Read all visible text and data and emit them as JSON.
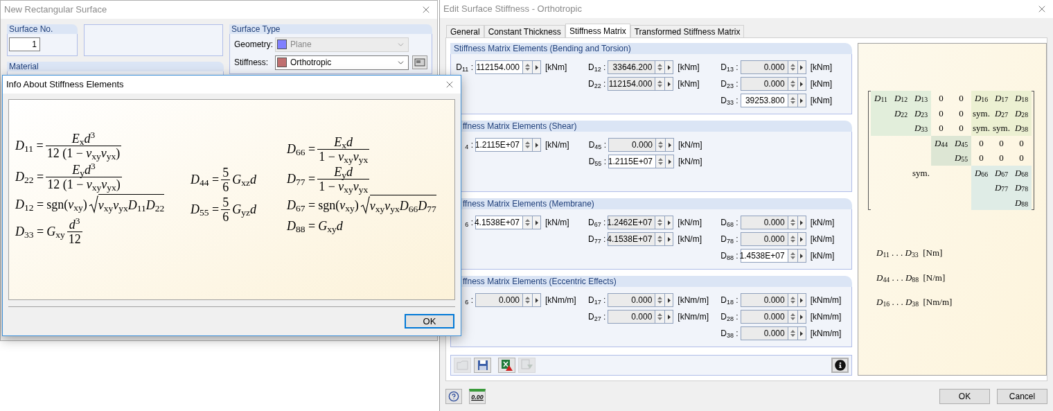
{
  "left_window": {
    "title": "New Rectangular Surface",
    "surface_no": {
      "label": "Surface No.",
      "value": "1"
    },
    "surface_type": {
      "title": "Surface Type",
      "rows": [
        {
          "label": "Geometry:",
          "value": "Plane",
          "color": "#8080ff",
          "disabled": true
        },
        {
          "label": "Stiffness:",
          "value": "Orthotropic",
          "color": "#c07070",
          "disabled": false
        }
      ]
    },
    "material": {
      "title": "Material"
    }
  },
  "info_dialog": {
    "title": "Info About Stiffness Elements",
    "columns": [
      [
        {
          "kind": "fraction",
          "lhs": "*D*$_{11}$ =",
          "num": "*E*$_{x}$*d*$^{3}$",
          "den": "12 (1 − *ν*$_{xy}$*ν*$_{yx}$)"
        },
        {
          "kind": "fraction",
          "lhs": "*D*$_{22}$ =",
          "num": "*E*$_{y}$*d*$^{3}$",
          "den": "12 (1 − *ν*$_{xy}$*ν*$_{yx}$)"
        },
        {
          "kind": "sqrt",
          "lhs": "*D*$_{12}$ =",
          "prefix": "sgn(*ν*$_{xy}$)",
          "radicand": "*ν*$_{xy}$*ν*$_{yx}$*D*$_{11}$*D*$_{22}$"
        },
        {
          "kind": "fraction",
          "lhs": "*D*$_{33}$ =",
          "prefix": "*G*$_{xy}$",
          "num": "*d*$^{3}$",
          "den": "12"
        }
      ],
      [
        {
          "kind": "fraction",
          "lhs": "*D*$_{44}$ =",
          "num": "5",
          "den": "6",
          "suffix": "*G*$_{xz}$*d*"
        },
        {
          "kind": "fraction",
          "lhs": "*D*$_{55}$ =",
          "num": "5",
          "den": "6",
          "suffix": "*G*$_{yz}$*d*"
        }
      ],
      [
        {
          "kind": "fraction",
          "lhs": "*D*$_{66}$ =",
          "num": "*E*$_{x}$*d*",
          "den": "1 − *ν*$_{xy}$*ν*$_{yx}$"
        },
        {
          "kind": "fraction",
          "lhs": "*D*$_{77}$ =",
          "num": "*E*$_{y}$*d*",
          "den": "1 − *ν*$_{xy}$*ν*$_{yx}$"
        },
        {
          "kind": "sqrt",
          "lhs": "*D*$_{67}$ =",
          "prefix": "sgn(*ν*$_{xy}$)",
          "radicand": "*ν*$_{xy}$*ν*$_{yx}$*D*$_{66}$*D*$_{77}$"
        },
        {
          "kind": "plain",
          "lhs": "*D*$_{88}$ =",
          "rhs": "*G*$_{xy}$*d*"
        }
      ]
    ],
    "ok": "OK"
  },
  "stiffness_window": {
    "title": "Edit Surface Stiffness - Orthotropic",
    "tabs": [
      {
        "label": "General",
        "selected": false
      },
      {
        "label": "Constant Thickness",
        "selected": false
      },
      {
        "label": "Stiffness Matrix",
        "selected": true
      },
      {
        "label": "Transformed Stiffness Matrix",
        "selected": false
      }
    ],
    "groups": [
      {
        "title": "Stiffness Matrix Elements (Bending and Torsion)",
        "covered": false,
        "rows": [
          [
            {
              "label": "D$_{11}$ :",
              "value": "112154.000",
              "unit": "[kNm]",
              "disabled": false
            },
            {
              "label": "D$_{12}$ :",
              "value": "33646.200",
              "unit": "[kNm]",
              "disabled": true
            },
            {
              "label": "D$_{13}$ :",
              "value": "0.000",
              "unit": "[kNm]",
              "disabled": true
            }
          ],
          [
            "",
            {
              "label": "D$_{22}$ :",
              "value": "112154.000",
              "unit": "[kNm]",
              "disabled": true
            },
            {
              "label": "D$_{23}$ :",
              "value": "0.000",
              "unit": "[kNm]",
              "disabled": true
            }
          ],
          [
            "",
            "",
            {
              "label": "D$_{33}$ :",
              "value": "39253.800",
              "unit": "[kNm]",
              "disabled": false
            }
          ]
        ]
      },
      {
        "title": "ffness Matrix Elements (Shear)",
        "covered": true,
        "rows": [
          [
            {
              "label": "$_{4}$ :",
              "value": "1.2115E+07",
              "unit": "[kN/m]",
              "disabled": false
            },
            {
              "label": "D$_{45}$ :",
              "value": "0.000",
              "unit": "[kN/m]",
              "disabled": true
            }
          ],
          [
            "",
            {
              "label": "D$_{55}$ :",
              "value": "1.2115E+07",
              "unit": "[kN/m]",
              "disabled": false
            }
          ]
        ]
      },
      {
        "title": "ffness Matrix Elements (Membrane)",
        "covered": true,
        "rows": [
          [
            {
              "label": "$_{6}$ :",
              "value": "4.1538E+07",
              "unit": "[kN/m]",
              "disabled": false
            },
            {
              "label": "D$_{67}$ :",
              "value": "1.2462E+07",
              "unit": "[kN/m]",
              "disabled": true
            },
            {
              "label": "D$_{68}$ :",
              "value": "0.000",
              "unit": "[kN/m]",
              "disabled": true
            }
          ],
          [
            "",
            {
              "label": "D$_{77}$ :",
              "value": "4.1538E+07",
              "unit": "[kN/m]",
              "disabled": true
            },
            {
              "label": "D$_{78}$ :",
              "value": "0.000",
              "unit": "[kN/m]",
              "disabled": true
            }
          ],
          [
            "",
            "",
            {
              "label": "D$_{88}$ :",
              "value": "1.4538E+07",
              "unit": "[kN/m]",
              "disabled": false
            }
          ]
        ]
      },
      {
        "title": "ffness Matrix Elements (Eccentric Effects)",
        "covered": true,
        "rows": [
          [
            {
              "label": "$_{6}$ :",
              "value": "0.000",
              "unit": "[kNm/m]",
              "disabled": true
            },
            {
              "label": "D$_{17}$ :",
              "value": "0.000",
              "unit": "[kNm/m]",
              "disabled": true
            },
            {
              "label": "D$_{18}$ :",
              "value": "0.000",
              "unit": "[kNm/m]",
              "disabled": true
            }
          ],
          [
            "",
            {
              "label": "D$_{27}$ :",
              "value": "0.000",
              "unit": "[kNm/m]",
              "disabled": true
            },
            {
              "label": "D$_{28}$ :",
              "value": "0.000",
              "unit": "[kNm/m]",
              "disabled": true
            }
          ],
          [
            "",
            "",
            {
              "label": "D$_{38}$ :",
              "value": "0.000",
              "unit": "[kNm/m]",
              "disabled": true
            }
          ]
        ]
      }
    ],
    "toolbar": [
      {
        "kind": "folder",
        "disabled": true,
        "pressed": false
      },
      {
        "kind": "save",
        "disabled": false,
        "pressed": false
      },
      {
        "kind": "excel",
        "disabled": false,
        "pressed": false
      },
      {
        "kind": "import",
        "disabled": true,
        "pressed": false
      },
      {
        "kind": "info",
        "disabled": false,
        "pressed": true
      }
    ],
    "matrix": {
      "rows": [
        {
          "cells": [
            "*D*$_{11}$",
            "*D*$_{12}$",
            "*D*$_{13}$",
            "0",
            "0",
            "*D*$_{16}$",
            "*D*$_{17}$",
            "*D*$_{18}$"
          ]
        },
        {
          "cells": [
            "",
            "*D*$_{22}$",
            "*D*$_{23}$",
            "0",
            "0",
            "sym.",
            "*D*$_{27}$",
            "*D*$_{28}$"
          ]
        },
        {
          "cells": [
            "",
            "",
            "*D*$_{33}$",
            "0",
            "0",
            "sym.",
            "sym.",
            "*D*$_{38}$"
          ]
        },
        {
          "cells": [
            "",
            "",
            "",
            "*D*$_{44}$",
            "*D*$_{45}$",
            "0",
            "0",
            "0"
          ]
        },
        {
          "cells": [
            "",
            "",
            "",
            "",
            "*D*$_{55}$",
            "0",
            "0",
            "0"
          ]
        },
        {
          "cells": [
            "",
            "",
            "sym.",
            "",
            "",
            "*D*$_{66}$",
            "*D*$_{67}$",
            "*D*$_{68}$"
          ]
        },
        {
          "cells": [
            "",
            "",
            "",
            "",
            "",
            "",
            "*D*$_{77}$",
            "*D*$_{78}$"
          ]
        },
        {
          "cells": [
            "",
            "",
            "",
            "",
            "",
            "",
            "",
            "*D*$_{88}$"
          ]
        }
      ]
    },
    "units": [
      "*D*$_{11}$ . . . *D*$_{33}$  [Nm]",
      "*D*$_{44}$ . . . *D*$_{88}$  [N/m]",
      "*D*$_{16}$ . . . *D*$_{38}$  [Nm/m]"
    ],
    "footer": {
      "tools": [
        {
          "kind": "help"
        },
        {
          "kind": "decimals",
          "label": "0.00"
        }
      ],
      "buttons": [
        "OK",
        "Cancel"
      ]
    }
  }
}
